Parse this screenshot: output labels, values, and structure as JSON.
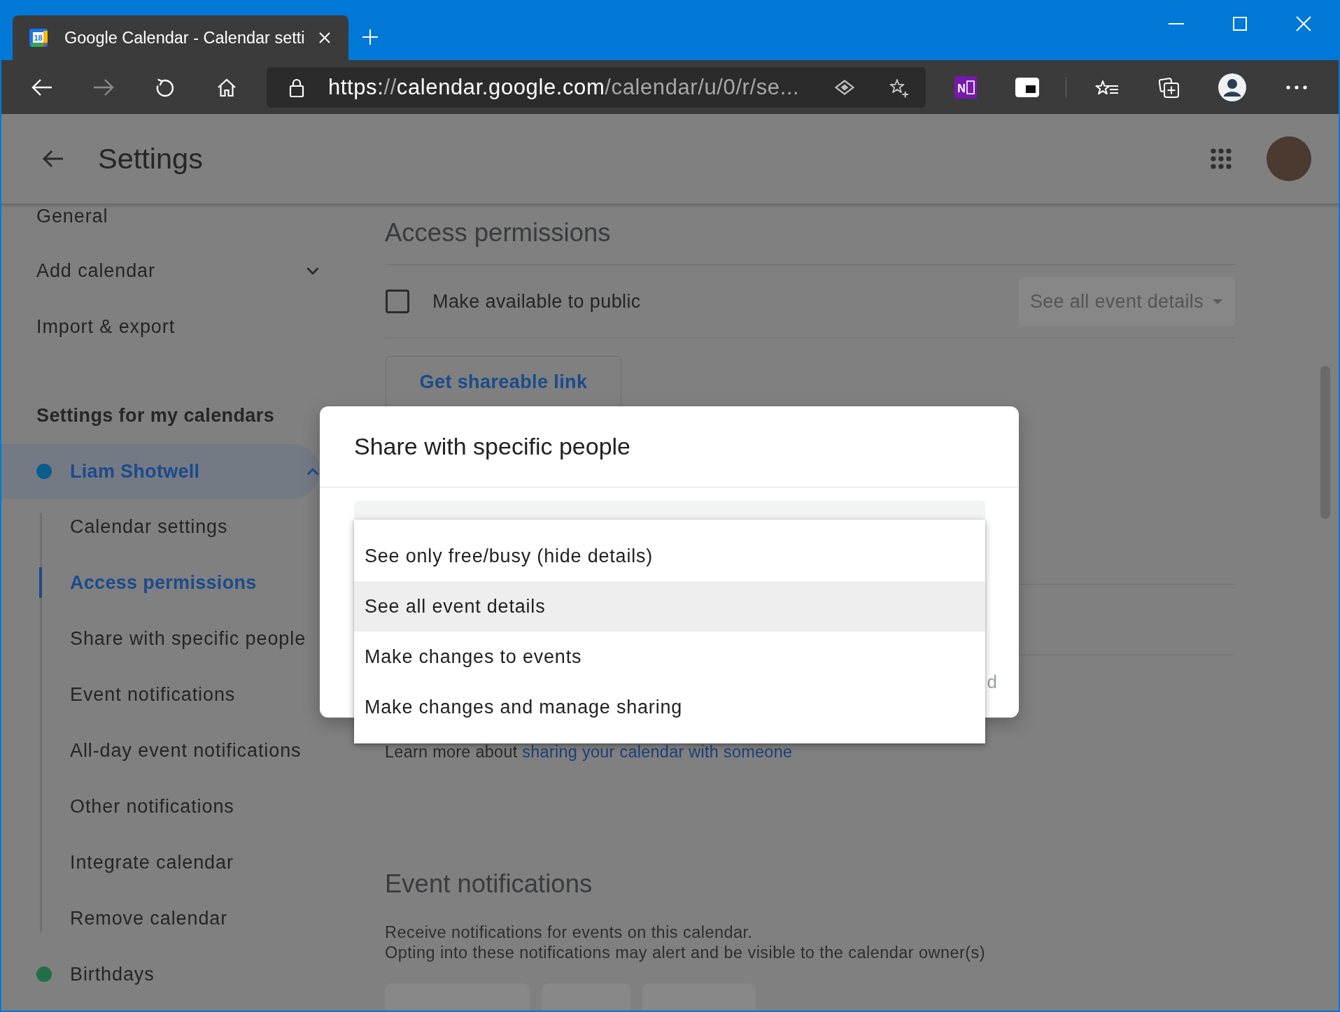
{
  "browser": {
    "tab": {
      "favicon_label": "18",
      "title": "Google Calendar - Calendar setti"
    },
    "nav": {
      "back_disabled": false,
      "forward_disabled": true
    },
    "url": [
      {
        "text": "https:",
        "dim": false
      },
      {
        "text": "//",
        "dim": true
      },
      {
        "text": "calendar.google.com",
        "dim": false
      },
      {
        "text": "/calendar/u/0/r/se...",
        "dim": true
      }
    ],
    "extension_label": "N"
  },
  "header": {
    "title": "Settings"
  },
  "sidebar": {
    "items": [
      {
        "label": "General",
        "selected": false
      },
      {
        "label": "Add calendar",
        "selected": false,
        "expanded": false
      },
      {
        "label": "Import & export",
        "selected": false
      }
    ],
    "section_title": "Settings for my calendars",
    "calendars": [
      {
        "name": "Liam Shotwell",
        "color": "#0b5d8c",
        "selected": true,
        "expanded": true,
        "children": [
          {
            "label": "Calendar settings",
            "selected": false
          },
          {
            "label": "Access permissions",
            "selected": true
          },
          {
            "label": "Share with specific people",
            "selected": false
          },
          {
            "label": "Event notifications",
            "selected": false
          },
          {
            "label": "All-day event notifications",
            "selected": false
          },
          {
            "label": "Other notifications",
            "selected": false
          },
          {
            "label": "Integrate calendar",
            "selected": false
          },
          {
            "label": "Remove calendar",
            "selected": false
          }
        ]
      },
      {
        "name": "Birthdays",
        "color": "#1f6f48",
        "selected": false
      }
    ]
  },
  "access_permissions": {
    "title": "Access permissions",
    "public_option": {
      "label": "Make available to public",
      "checked": false,
      "dropdown": "See all event details",
      "dropdown_disabled": true
    },
    "link_button": "Get shareable link",
    "learn_more": {
      "text": "Learn more about",
      "link": "sharing your calendar with someone"
    }
  },
  "dialog": {
    "title": "Share with specific people",
    "fields": [
      {
        "kind": "input"
      }
    ],
    "menu": {
      "items": [
        {
          "label": "See only free/busy (hide details)",
          "selected": false
        },
        {
          "label": "See all event details",
          "selected": true
        },
        {
          "label": "Make changes to events",
          "selected": false
        },
        {
          "label": "Make changes and manage sharing",
          "selected": false
        }
      ]
    },
    "buttons": [
      {
        "label": "d",
        "disabled": true
      }
    ]
  },
  "event_notifications": {
    "title": "Event notifications",
    "description": [
      "Receive notifications for events on this calendar.",
      "Opting into these notifications may alert and be visible to the calendar owner(s)"
    ],
    "fields": [
      {
        "kind": "dropdown"
      },
      {
        "kind": "dropdown"
      },
      {
        "kind": "dropdown"
      }
    ]
  }
}
